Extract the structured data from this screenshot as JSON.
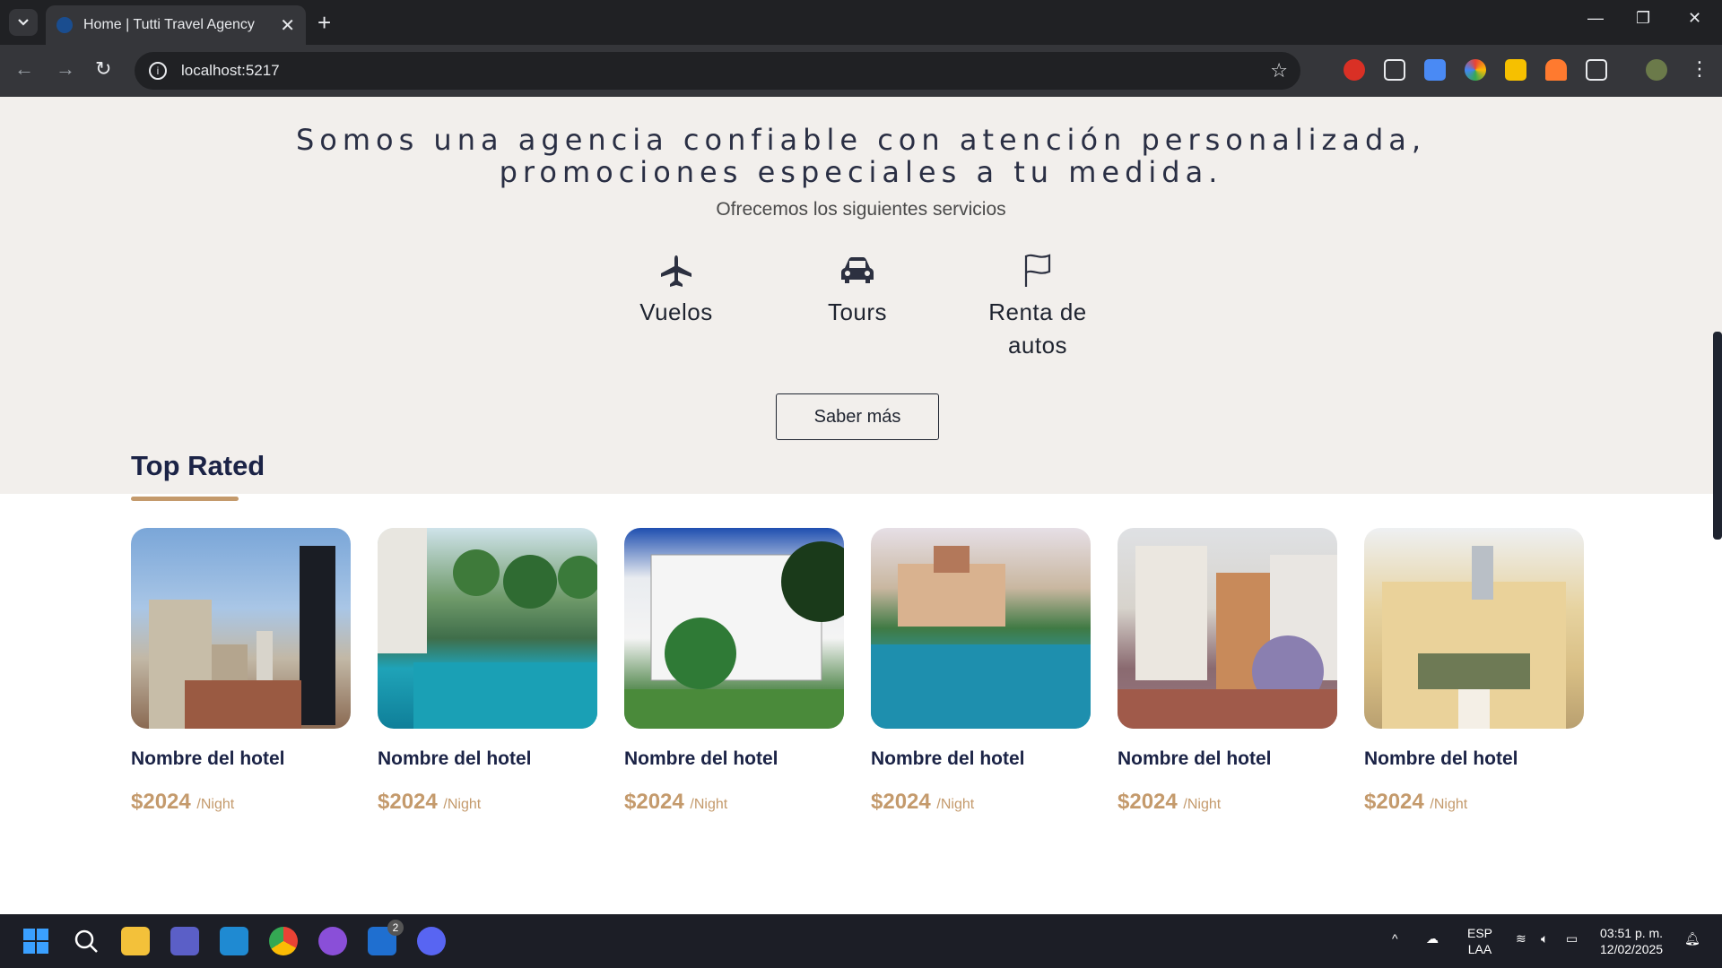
{
  "browser": {
    "tab_title": "Home | Tutti Travel Agency",
    "url": "localhost:5217",
    "new_tab": "+",
    "close_tab": "✕"
  },
  "services": {
    "headline_line1": "Somos una agencia confiable con atención personalizada,",
    "headline_line2": "promociones especiales a tu medida.",
    "subtitle": "Ofrecemos los siguientes servicios",
    "items": [
      {
        "label": "Vuelos",
        "icon": "plane-icon"
      },
      {
        "label": "Tours",
        "icon": "car-icon"
      },
      {
        "label": "Renta de autos",
        "icon": "flag-icon"
      }
    ],
    "button": "Saber más"
  },
  "top_rated": {
    "title": "Top Rated",
    "hotels": [
      {
        "name": "Nombre del hotel",
        "price": "$2024",
        "unit": "/Night"
      },
      {
        "name": "Nombre del hotel",
        "price": "$2024",
        "unit": "/Night"
      },
      {
        "name": "Nombre del hotel",
        "price": "$2024",
        "unit": "/Night"
      },
      {
        "name": "Nombre del hotel",
        "price": "$2024",
        "unit": "/Night"
      },
      {
        "name": "Nombre del hotel",
        "price": "$2024",
        "unit": "/Night"
      },
      {
        "name": "Nombre del hotel",
        "price": "$2024",
        "unit": "/Night"
      }
    ]
  },
  "taskbar": {
    "lang": "ESP",
    "layout": "LAA",
    "time": "03:51 p. m.",
    "date": "12/02/2025",
    "badge_count": "2"
  },
  "colors": {
    "accent": "#c49a6c",
    "navy": "#1b2346",
    "section_bg": "#f2efec"
  }
}
